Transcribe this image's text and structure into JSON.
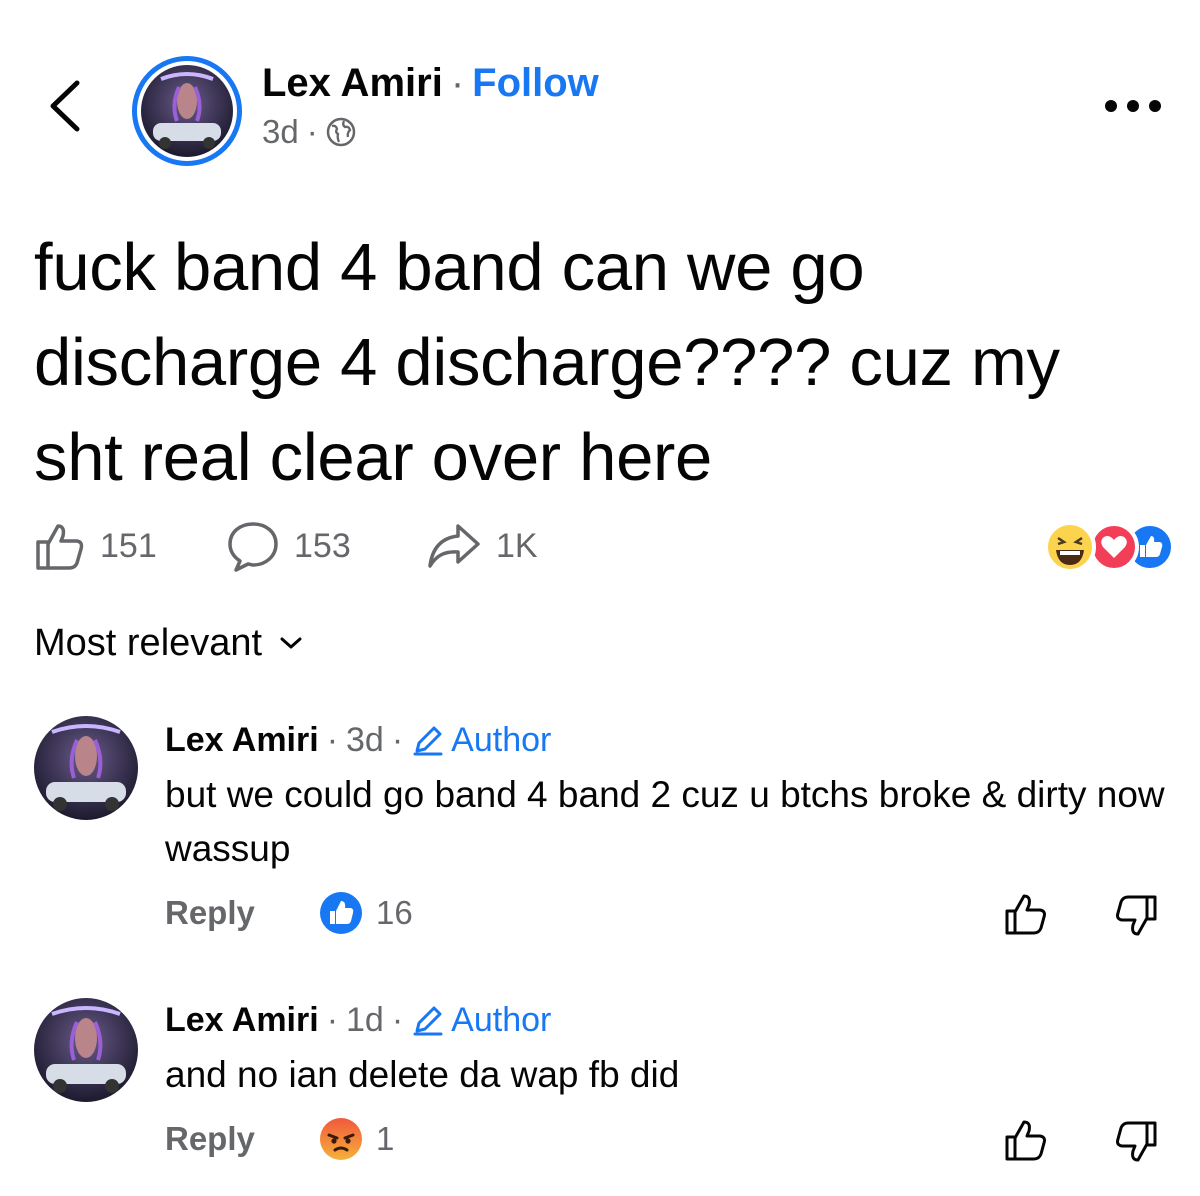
{
  "header": {
    "author_name": "Lex Amiri",
    "separator": "·",
    "follow_label": "Follow",
    "time": "3d"
  },
  "post": {
    "text": "fuck band 4 band can we go discharge 4 discharge???? cuz my sht real clear over here"
  },
  "actions": {
    "likes": "151",
    "comments": "153",
    "shares": "1K"
  },
  "sort": {
    "label": "Most relevant"
  },
  "comments": [
    {
      "name": "Lex Amiri",
      "time": "3d",
      "badge": "Author",
      "text": "but we could go band 4 band 2 cuz u btchs broke & dirty now wassup",
      "reply_label": "Reply",
      "reaction_count": "16"
    },
    {
      "name": "Lex Amiri",
      "time": "1d",
      "badge": "Author",
      "text": "and no ian delete da wap fb did",
      "reply_label": "Reply",
      "reaction_count": "1"
    }
  ],
  "colors": {
    "accent": "#1877f2",
    "secondary_text": "#65676b",
    "love": "#f33e58",
    "angry": "#e9710f"
  }
}
